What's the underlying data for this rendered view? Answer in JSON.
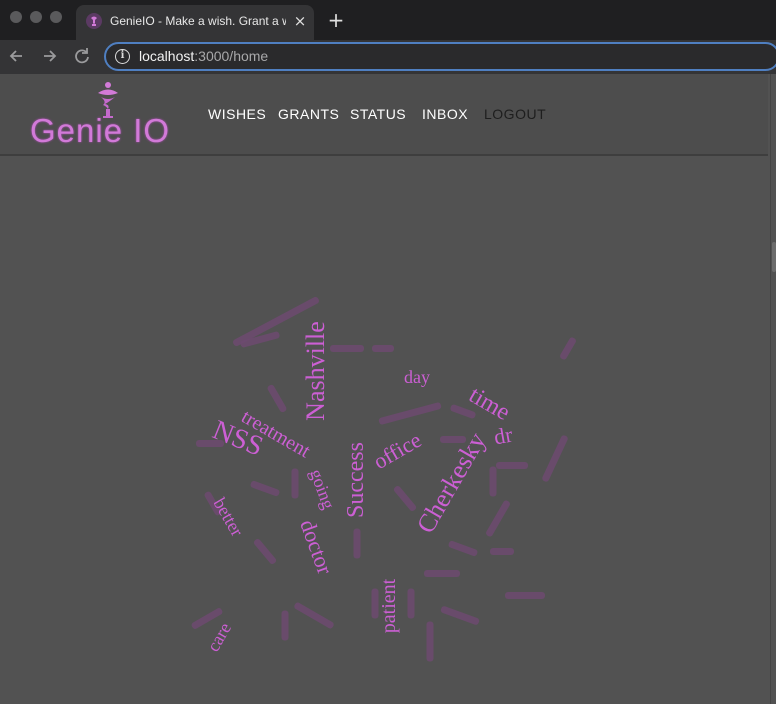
{
  "browser": {
    "tab_title": "GenieIO - Make a wish. Grant a w",
    "tab_close": "×",
    "new_tab": "+",
    "url_host": "localhost",
    "url_path": ":3000/home",
    "back_icon": "arrow-left-icon",
    "forward_icon": "arrow-right-icon",
    "reload_icon": "reload-icon"
  },
  "app": {
    "logo_text": "Genie IO",
    "nav": [
      "WISHES",
      "GRANTS",
      "STATUS",
      "INBOX",
      "LOGOUT"
    ],
    "accent_color": "#cc5fd4"
  },
  "word_cloud": {
    "words": [
      "Nashville",
      "NSS",
      "treatment",
      "Success",
      "going",
      "office",
      "day",
      "time",
      "dr",
      "Cherkesky",
      "better",
      "doctor",
      "patient",
      "care"
    ]
  }
}
